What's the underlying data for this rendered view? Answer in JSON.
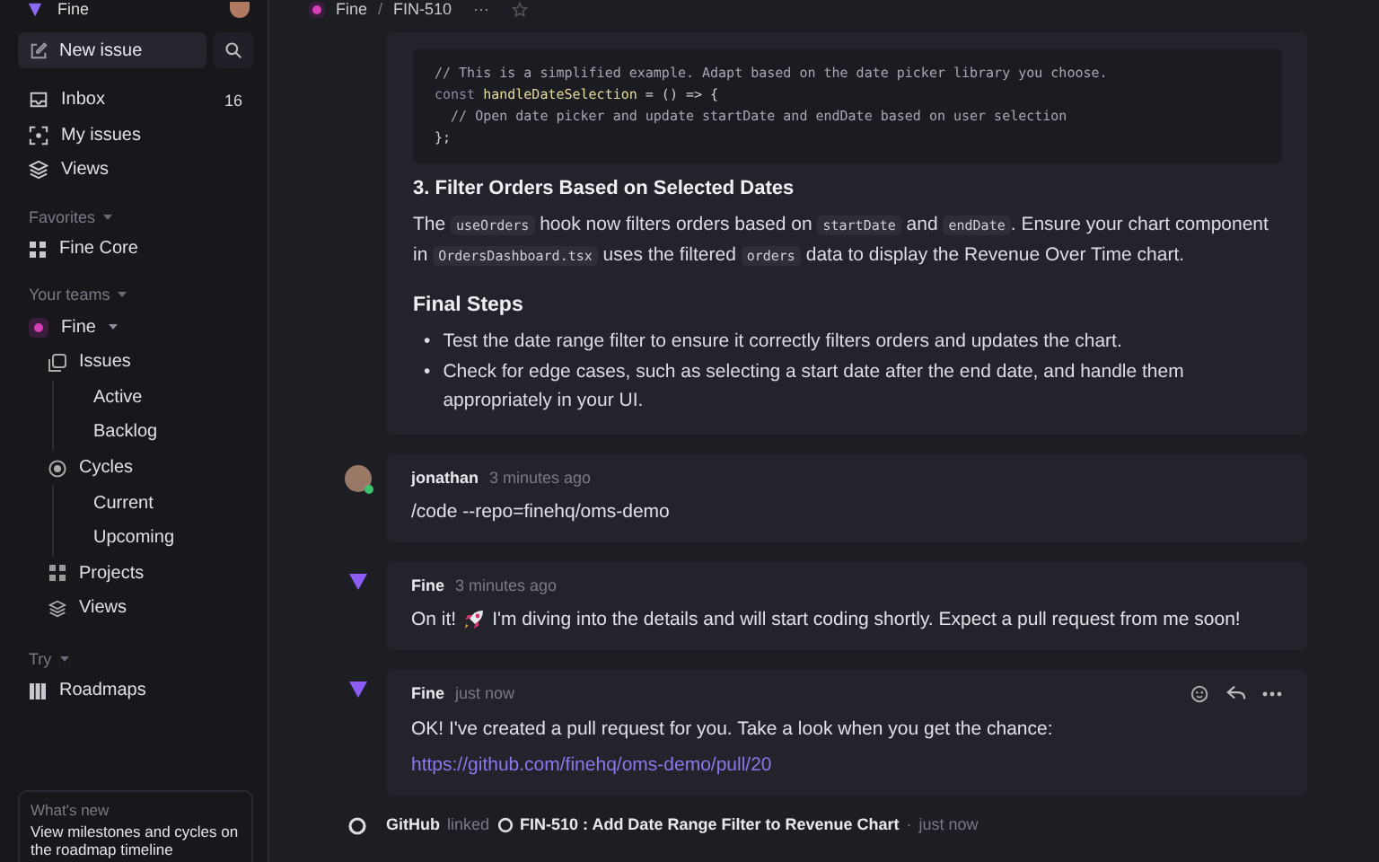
{
  "sidebar": {
    "workspace": "Fine",
    "new_issue": "New issue",
    "nav": [
      {
        "label": "Inbox",
        "count": "16"
      },
      {
        "label": "My issues"
      },
      {
        "label": "Views"
      }
    ],
    "favorites": {
      "title": "Favorites",
      "items": [
        {
          "label": "Fine Core"
        }
      ]
    },
    "teams": {
      "title": "Your teams",
      "items": [
        {
          "label": "Fine",
          "expanded": true,
          "children": [
            {
              "label": "Issues",
              "children": [
                {
                  "label": "Active"
                },
                {
                  "label": "Backlog"
                }
              ]
            },
            {
              "label": "Cycles",
              "children": [
                {
                  "label": "Current"
                },
                {
                  "label": "Upcoming"
                }
              ]
            },
            {
              "label": "Projects"
            },
            {
              "label": "Views"
            }
          ]
        }
      ]
    },
    "try": {
      "title": "Try",
      "items": [
        {
          "label": "Roadmaps"
        }
      ]
    },
    "whats_new": {
      "title": "What's new",
      "text": "View milestones and cycles on the roadmap timeline"
    }
  },
  "breadcrumb": {
    "team": "Fine",
    "separator": "/",
    "issue": "FIN-510",
    "more": "···"
  },
  "description": {
    "code": [
      [
        {
          "kind": "comment",
          "text": "// This is a simplified example. Adapt based on the date picker library you choose."
        }
      ],
      [
        {
          "kind": "keyword",
          "text": "const "
        },
        {
          "kind": "function",
          "text": "handleDateSelection"
        },
        {
          "kind": "plain",
          "text": " = () => {"
        }
      ],
      [
        {
          "kind": "comment",
          "text": "  // Open date picker and update startDate and endDate based on user selection"
        }
      ],
      [
        {
          "kind": "plain",
          "text": "};"
        }
      ]
    ],
    "heading": "3. Filter Orders Based on Selected Dates",
    "paragraph": [
      {
        "kind": "text",
        "text": "The "
      },
      {
        "kind": "code",
        "text": "useOrders"
      },
      {
        "kind": "text",
        "text": " hook now filters orders based on "
      },
      {
        "kind": "code",
        "text": "startDate"
      },
      {
        "kind": "text",
        "text": " and "
      },
      {
        "kind": "code",
        "text": "endDate"
      },
      {
        "kind": "text",
        "text": ". Ensure your chart component in "
      },
      {
        "kind": "code",
        "text": "OrdersDashboard.tsx"
      },
      {
        "kind": "text",
        "text": " uses the filtered "
      },
      {
        "kind": "code",
        "text": "orders"
      },
      {
        "kind": "text",
        "text": " data to display the Revenue Over Time chart."
      }
    ],
    "subheading": "Final Steps",
    "bullets": [
      {
        "marker": "•",
        "text": "Test the date range filter to ensure it correctly filters orders and updates the chart."
      },
      {
        "marker": "•",
        "text": "Check for edge cases, such as selecting a start date after the end date, and handle them appropriately in your UI."
      }
    ]
  },
  "comments": [
    {
      "kind": "user",
      "author": "jonathan",
      "time": "3 minutes ago",
      "hovered": false,
      "lines": [
        [
          {
            "kind": "text",
            "text": "/code --repo=finehq/oms-demo"
          }
        ]
      ]
    },
    {
      "kind": "bot",
      "author": "Fine",
      "time": "3 minutes ago",
      "hovered": false,
      "lines": [
        [
          {
            "kind": "text",
            "text": "On it!"
          },
          {
            "kind": "emoji"
          },
          {
            "kind": "text",
            "text": "I'm diving into the details and will start coding shortly. Expect a pull request from me soon!"
          }
        ]
      ]
    },
    {
      "kind": "bot",
      "author": "Fine",
      "time": "just now",
      "hovered": true,
      "lines": [
        [
          {
            "kind": "text",
            "text": "OK! I've created a pull request for you. Take a look when you get the chance:"
          }
        ],
        [
          {
            "kind": "link",
            "text": "https://github.com/finehq/oms-demo/pull/20"
          }
        ]
      ]
    }
  ],
  "activity": {
    "source": "GitHub",
    "verb": "linked",
    "issue": "FIN-510 : Add Date Range Filter to Revenue Chart",
    "separator": "·",
    "time": "just now"
  }
}
